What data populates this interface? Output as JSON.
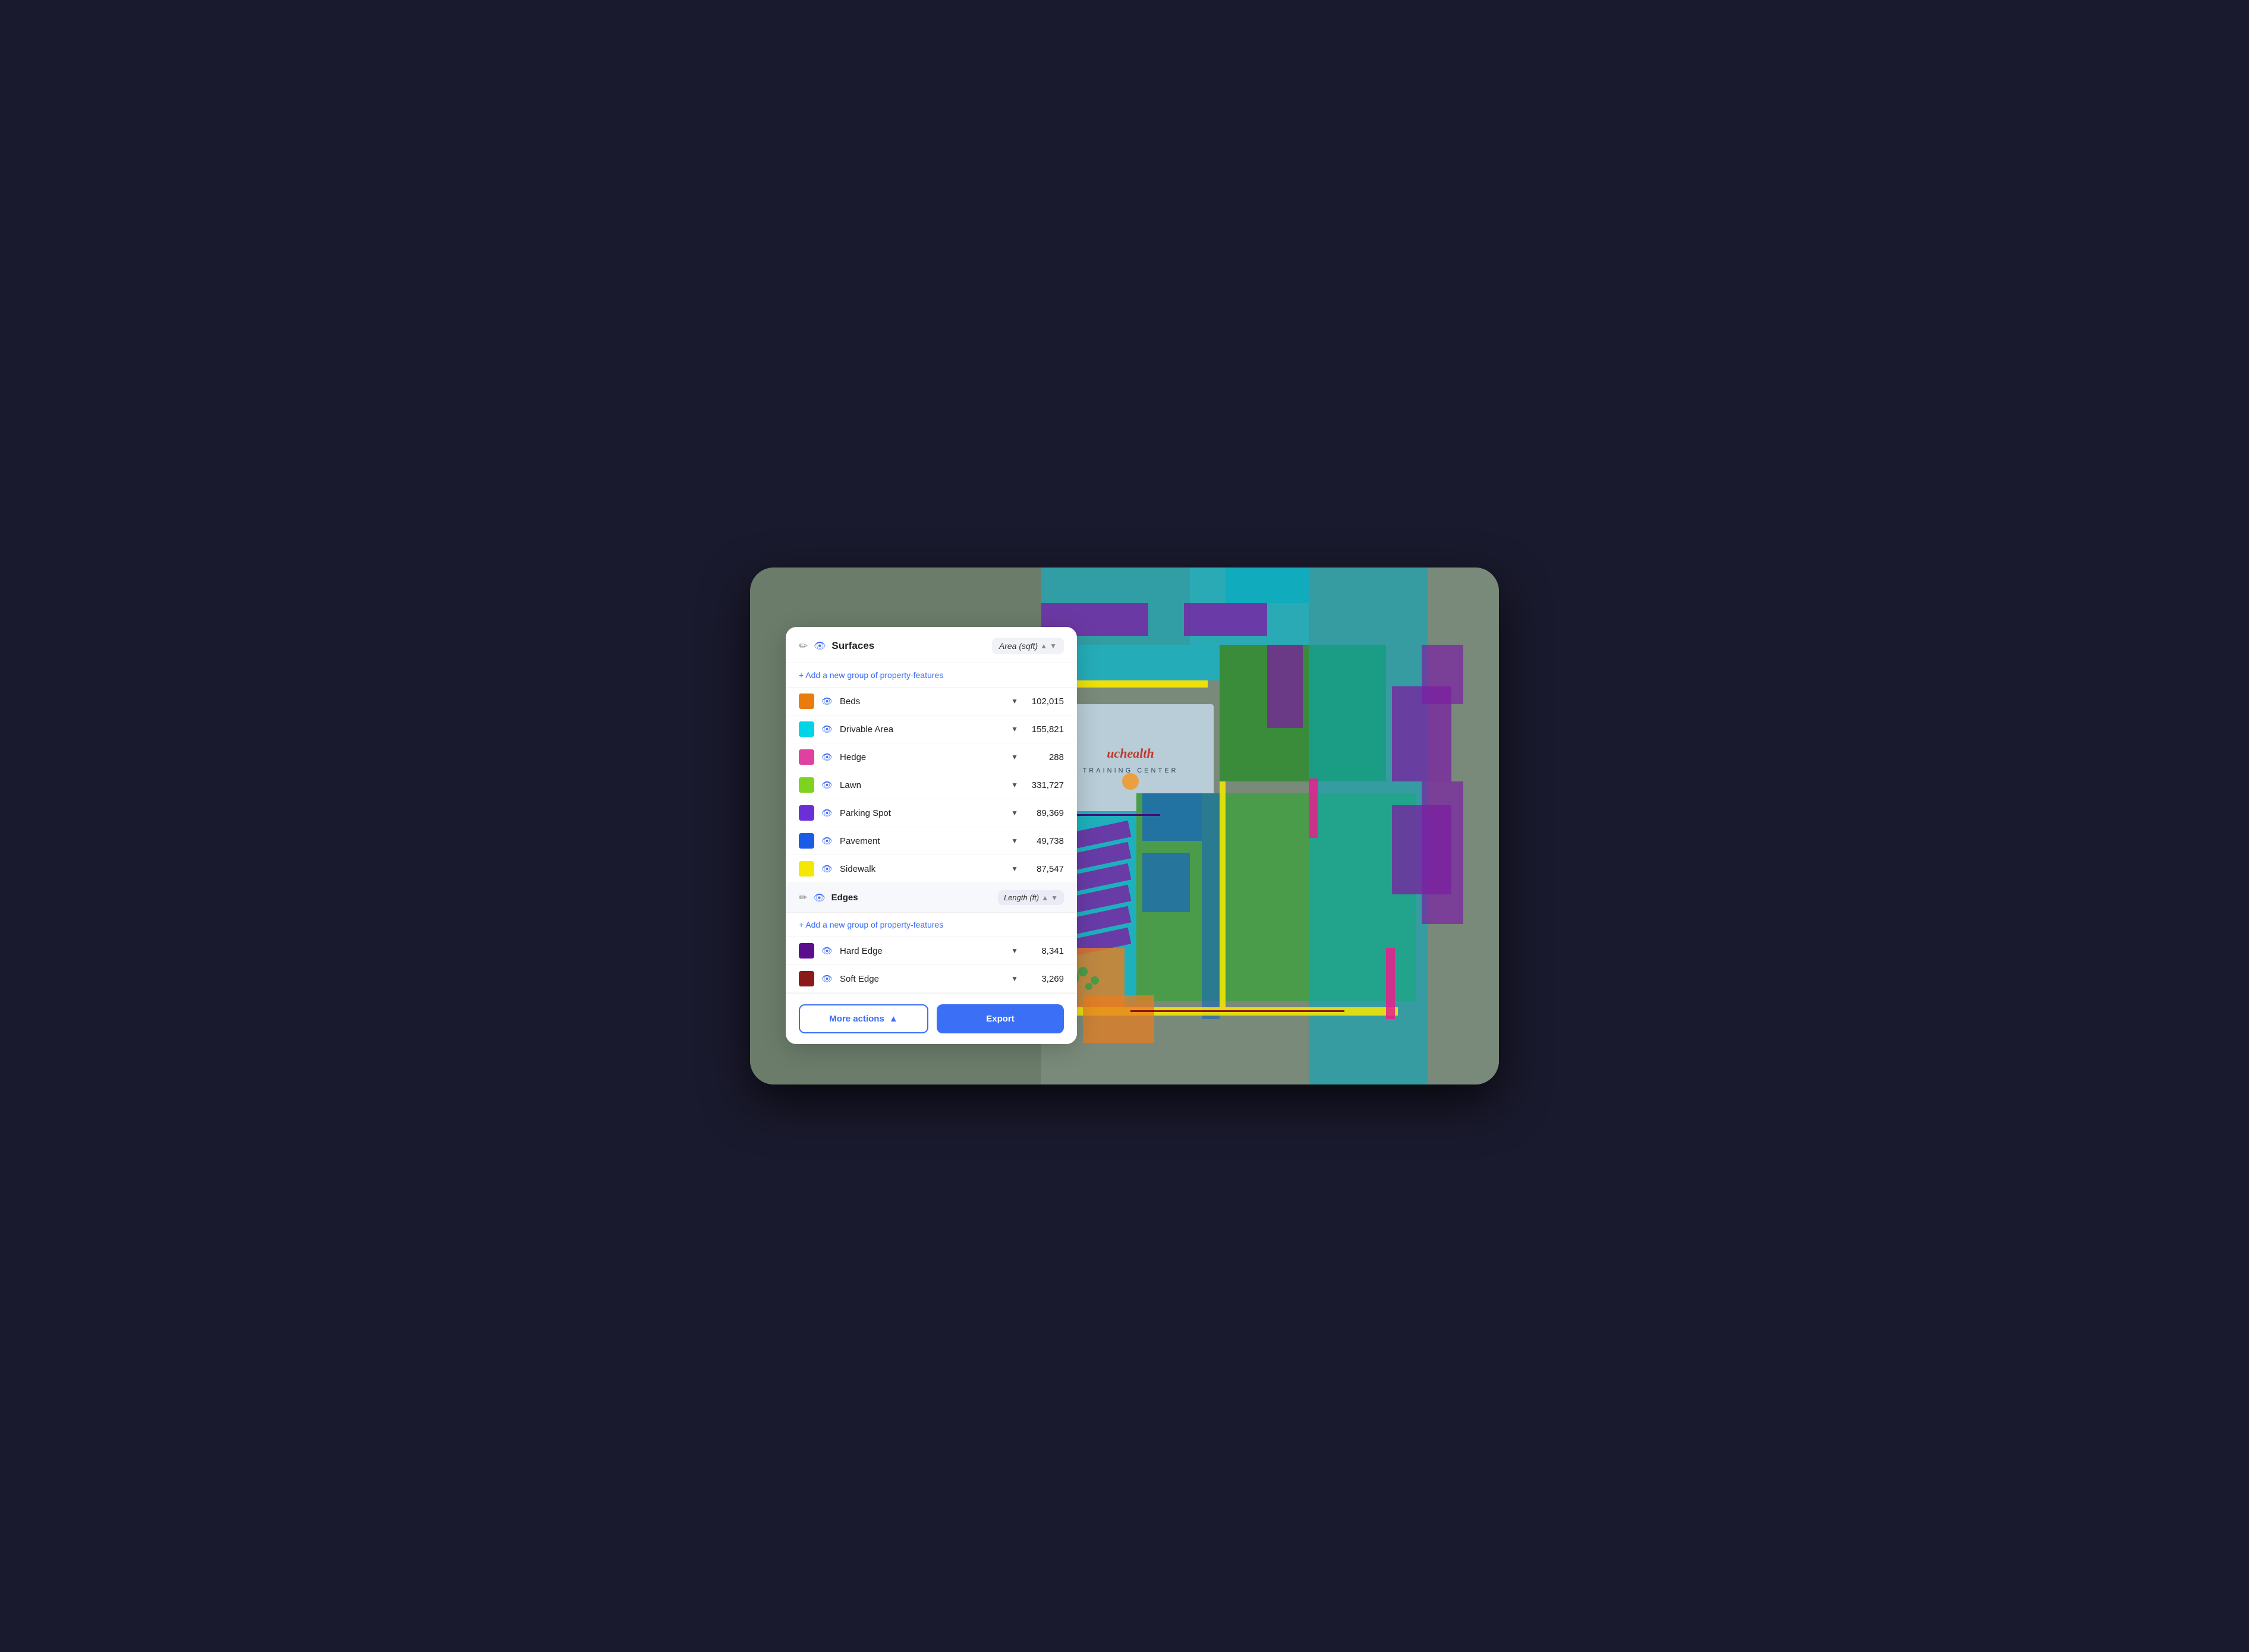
{
  "panel": {
    "header": {
      "icon": "✏",
      "surfaces_label": "Surfaces",
      "area_label": "Area (sqft)",
      "chevron": "▼"
    },
    "add_group_label": "+ Add a new group of property-features",
    "surfaces": [
      {
        "color": "#E87D0D",
        "label": "Beds",
        "value": "102,015"
      },
      {
        "color": "#00D4E8",
        "label": "Drivable Area",
        "value": "155,821"
      },
      {
        "color": "#E040A0",
        "label": "Hedge",
        "value": "288"
      },
      {
        "color": "#7ED321",
        "label": "Lawn",
        "value": "331,727"
      },
      {
        "color": "#6B2FD6",
        "label": "Parking Spot",
        "value": "89,369"
      },
      {
        "color": "#1A5CE8",
        "label": "Pavement",
        "value": "49,738"
      },
      {
        "color": "#F4E800",
        "label": "Sidewalk",
        "value": "87,547"
      }
    ],
    "edges_section": {
      "icon": "✏",
      "label": "Edges",
      "length_label": "Length (ft)"
    },
    "add_group_label_2": "+ Add a new group of property-features",
    "edges": [
      {
        "color": "#5B0E8E",
        "label": "Hard Edge",
        "value": "8,341"
      },
      {
        "color": "#8B1A1A",
        "label": "Soft Edge",
        "value": "3,269"
      }
    ],
    "footer": {
      "more_actions_label": "More actions",
      "more_actions_icon": "▲",
      "export_label": "Export"
    }
  },
  "map": {
    "title": "UCHealth Training Center",
    "aerial_description": "Aerial view with colored surface overlays"
  }
}
